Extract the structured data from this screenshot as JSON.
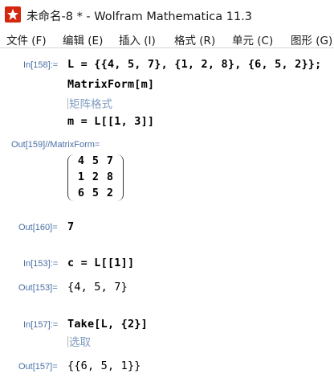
{
  "window": {
    "title": "未命名-8 * - Wolfram Mathematica 11.3",
    "app_icon": "mathematica-logo-icon"
  },
  "menu": {
    "items": [
      "文件 (F)",
      "编辑 (E)",
      "插入 (I)",
      "格式 (R)",
      "单元 (C)",
      "图形 (G)"
    ]
  },
  "cells": {
    "in158": {
      "label": "In[158]:=",
      "line1": "L = {{4, 5, 7}, {1, 2, 8}, {6, 5, 2}};",
      "line2": "MatrixForm[m]",
      "comment": "矩阵格式",
      "line3": "m = L[[1, 3]]"
    },
    "out159": {
      "label": "Out[159]//MatrixForm=",
      "matrix": [
        [
          "4",
          "5",
          "7"
        ],
        [
          "1",
          "2",
          "8"
        ],
        [
          "6",
          "5",
          "2"
        ]
      ]
    },
    "out160": {
      "label": "Out[160]=",
      "value": "7"
    },
    "in153": {
      "label": "In[153]:=",
      "code": "c = L[[1]]"
    },
    "out153": {
      "label": "Out[153]=",
      "value": "{4, 5, 7}"
    },
    "in157": {
      "label": "In[157]:=",
      "code": "Take[L, {2}]",
      "comment": "选取"
    },
    "out157": {
      "label": "Out[157]=",
      "value": "{{6, 5, 1}}"
    }
  },
  "colors": {
    "label": "#4a6fa5",
    "comment": "#7f9dbf",
    "bracket": "#a9bcd6",
    "icon": "#d4270e"
  }
}
